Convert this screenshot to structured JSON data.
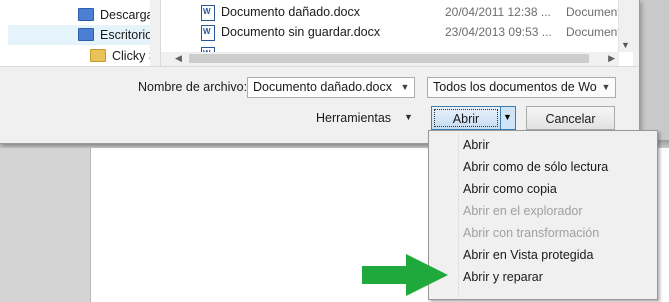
{
  "nav": {
    "items": [
      {
        "label": "Descargas",
        "icon": "download-folder-icon"
      },
      {
        "label": "Escritorio",
        "icon": "desktop-folder-icon",
        "selected": true
      },
      {
        "label": "Clicky Sof",
        "icon": "folder-icon"
      }
    ]
  },
  "files": [
    {
      "name": "Documento dañado.docx",
      "date": "20/04/2011 12:38 ...",
      "type": "Documento"
    },
    {
      "name": "Documento sin guardar.docx",
      "date": "23/04/2013 09:53 ...",
      "type": "Documento"
    }
  ],
  "filename": {
    "label": "Nombre de archivo:",
    "value": "Documento dañado.docx"
  },
  "filter": {
    "value": "Todos los documentos de Word"
  },
  "buttons": {
    "tools": "Herramientas",
    "open": "Abrir",
    "cancel": "Cancelar"
  },
  "open_menu": [
    {
      "label": "Abrir",
      "enabled": true
    },
    {
      "label": "Abrir como de sólo lectura",
      "enabled": true
    },
    {
      "label": "Abrir como copia",
      "enabled": true
    },
    {
      "label": "Abrir en el explorador",
      "enabled": false
    },
    {
      "label": "Abrir con transformación",
      "enabled": false
    },
    {
      "label": "Abrir en Vista protegida",
      "enabled": true
    },
    {
      "label": "Abrir y reparar",
      "enabled": true
    }
  ],
  "colors": {
    "highlight_arrow": "#1fa83b",
    "open_button_border": "#3c7fb1",
    "word_icon": "#2b5797"
  }
}
